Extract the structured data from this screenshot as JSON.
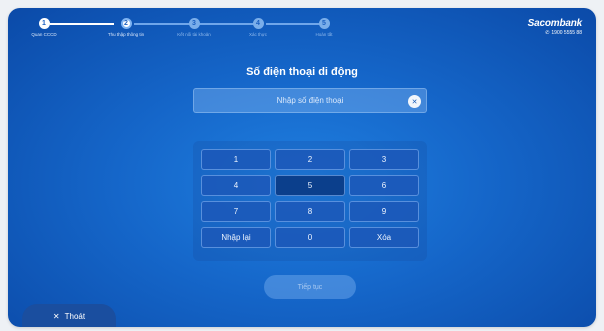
{
  "steps": [
    {
      "number": "1",
      "label": "Quan CCCD",
      "state": "done"
    },
    {
      "number": "2",
      "label": "Thu thập thông tin",
      "state": "active"
    },
    {
      "number": "3",
      "label": "Kết nối tài khoản",
      "state": "pending"
    },
    {
      "number": "4",
      "label": "Xác thực",
      "state": "pending"
    },
    {
      "number": "5",
      "label": "Hoàn tất",
      "state": "pending"
    }
  ],
  "brand": {
    "name": "Sacombank",
    "phone": "1900 5555 88",
    "phone_icon": "phone-icon"
  },
  "form": {
    "title": "Số điện thoại di động",
    "placeholder": "Nhập số điện thoại",
    "clear_icon": "clear-circle-icon"
  },
  "keypad": {
    "keys": [
      "1",
      "2",
      "3",
      "4",
      "5",
      "6",
      "7",
      "8",
      "9",
      "Nhập lại",
      "0",
      "Xóa"
    ],
    "pressed_key": "5"
  },
  "actions": {
    "continue_label": "Tiếp tục",
    "exit_label": "Thoát",
    "exit_icon": "close-icon"
  },
  "colors": {
    "background": "#1566c9",
    "accent": "#ffffff"
  }
}
